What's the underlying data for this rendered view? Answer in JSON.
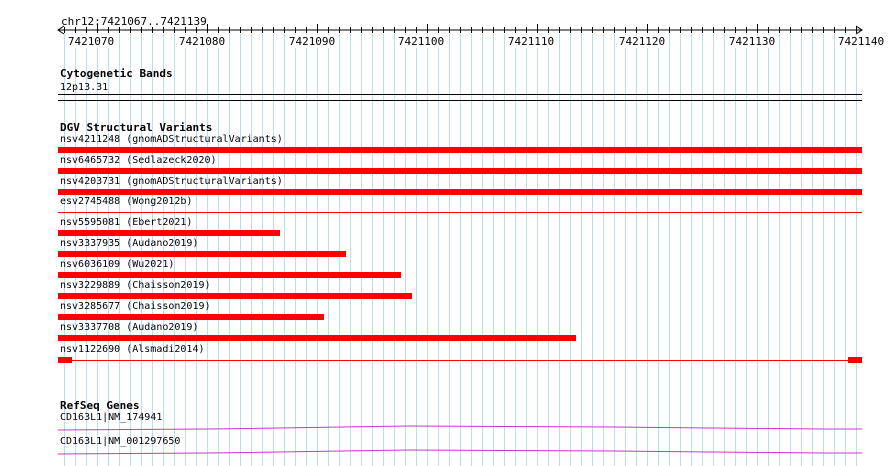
{
  "ruler": {
    "location": "chr12:7421067..7421139",
    "ticks": [
      "7421070",
      "7421080",
      "7421090",
      "7421100",
      "7421110",
      "7421120",
      "7421130",
      "7421140"
    ]
  },
  "tracks": {
    "cytoband": {
      "title": "Cytogenetic Bands",
      "band": "12p13.31"
    },
    "dgv": {
      "title": "DGV Structural Variants",
      "items": [
        {
          "label": "nsv4211248 (gnomADStructuralVariants)"
        },
        {
          "label": "nsv6465732 (Sedlazeck2020)"
        },
        {
          "label": "nsv4203731 (gnomADStructuralVariants)"
        },
        {
          "label": "esv2745488 (Wong2012b)"
        },
        {
          "label": "nsv5595081 (Ebert2021)"
        },
        {
          "label": "nsv3337935 (Audano2019)"
        },
        {
          "label": "nsv6036109 (Wu2021)"
        },
        {
          "label": "nsv3229889 (Chaisson2019)"
        },
        {
          "label": "nsv3285677 (Chaisson2019)"
        },
        {
          "label": "nsv3337708 (Audano2019)"
        },
        {
          "label": "nsv1122690 (Alsmadi2014)"
        }
      ]
    },
    "refseq": {
      "title": "RefSeq Genes",
      "items": [
        {
          "label": "CD163L1|NM_174941"
        },
        {
          "label": "CD163L1|NM_001297650"
        }
      ]
    }
  },
  "colors": {
    "variant": "#ff0000",
    "gene": "#cc33cc",
    "grid": "#b7dfee"
  }
}
